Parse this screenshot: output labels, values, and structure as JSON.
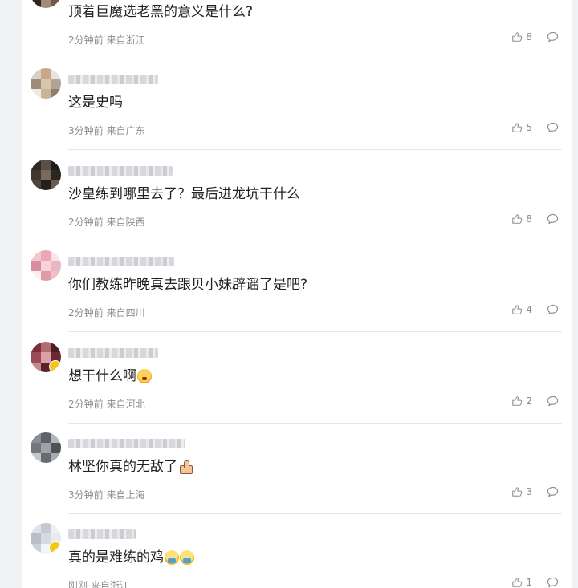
{
  "comments": [
    {
      "content": "顶着巨魔选老黑的意义是什么?",
      "time": "2分钟前",
      "location": "来自浙江",
      "likes": "8",
      "emoji": "",
      "avatar_colors": [
        "#6b4a3a",
        "#9c7b66",
        "#3a2a22",
        "#c7b19c",
        "#5d4437",
        "#8a6c5a",
        "#2f241e",
        "#a58b76",
        "#74584a"
      ]
    },
    {
      "content": "这是史吗",
      "time": "3分钟前",
      "location": "来自广东",
      "likes": "5",
      "emoji": "",
      "avatar_colors": [
        "#d6d0c8",
        "#c7a88a",
        "#e8e3dc",
        "#9d8c7a",
        "#d9c4ad",
        "#b0a496",
        "#efe9e2",
        "#c9b39b",
        "#8d7e6e"
      ]
    },
    {
      "content": "沙皇练到哪里去了？最后进龙坑干什么",
      "time": "2分钟前",
      "location": "来自陕西",
      "likes": "8",
      "emoji": "",
      "avatar_colors": [
        "#2d2a27",
        "#5a4f46",
        "#1e1c1a",
        "#3f3831",
        "#7a6a5c",
        "#2a2622",
        "#4d443c",
        "#241f1b",
        "#6b5d51"
      ]
    },
    {
      "content": "你们教练昨晚真去跟贝小妹辟谣了是吧?",
      "time": "2分钟前",
      "location": "来自四川",
      "likes": "4",
      "emoji": "",
      "avatar_colors": [
        "#f3c7cf",
        "#e8a9b5",
        "#fbe2e6",
        "#d98e9c",
        "#f6d2d9",
        "#e9b7c1",
        "#fdeef1",
        "#e29aa8",
        "#f0c0ca"
      ]
    },
    {
      "content": "想干什么啊",
      "time": "2分钟前",
      "location": "来自河北",
      "likes": "2",
      "emoji": "angry",
      "avatar_colors": [
        "#7a2f3a",
        "#b46a73",
        "#4a1d24",
        "#9a4b55",
        "#d8a2a8",
        "#6b2a33",
        "#c48990",
        "#5a2229",
        "#e6c3c6"
      ]
    },
    {
      "content": "林坚你真的无敌了",
      "time": "3分钟前",
      "location": "来自上海",
      "likes": "3",
      "emoji": "thumb",
      "avatar_colors": [
        "#8a8f96",
        "#5e6369",
        "#b3b7bc",
        "#72777d",
        "#9fa3a8",
        "#4e5257",
        "#c5c8cb",
        "#686c71",
        "#a8acb0"
      ]
    },
    {
      "content": "真的是难练的鸡",
      "time": "刚刚",
      "location": "来自浙江",
      "likes": "1",
      "emoji": "chick",
      "avatar_colors": [
        "#dfe3e8",
        "#c3cad2",
        "#eef1f4",
        "#b7c0c9",
        "#d5dbe1",
        "#e7eaee",
        "#c9d0d7",
        "#f2f4f6",
        "#bfc7cf"
      ]
    }
  ]
}
